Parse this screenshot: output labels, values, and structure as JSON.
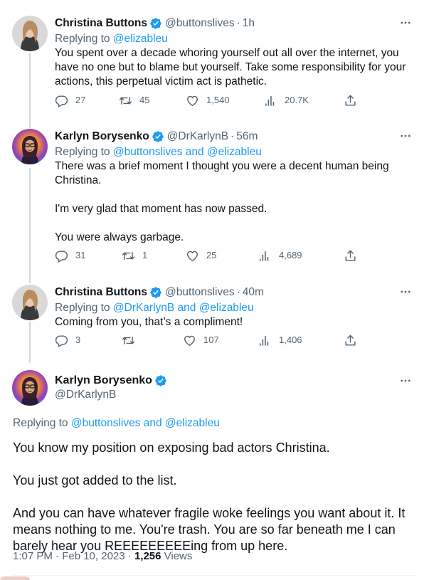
{
  "colors": {
    "accent": "#1d9bf0",
    "muted": "#536471",
    "text": "#0f1419",
    "verified": "#1d9bf0"
  },
  "tweets": [
    {
      "name": "Christina Buttons",
      "handle": "@buttonslives",
      "time": "1h",
      "replying_prefix": "Replying to ",
      "replying_to": "@elizableu",
      "text": "You spent over a decade whoring yourself out all over the internet, you have no one but to blame but yourself. Take some responsibility for your actions, this perpetual victim act is pathetic.",
      "replies": "27",
      "retweets": "45",
      "likes": "1,540",
      "views": "20.7K"
    },
    {
      "name": "Karlyn Borysenko",
      "handle": "@DrKarlynB",
      "time": "56m",
      "replying_prefix": "Replying to ",
      "replying_to": "@buttonslives and @elizableu",
      "text": "There was a brief moment I thought you were a decent human being Christina.\n\nI'm very glad that moment has now passed.\n\nYou were always garbage.",
      "replies": "31",
      "retweets": "1",
      "likes": "25",
      "views": "4,689"
    },
    {
      "name": "Christina Buttons",
      "handle": "@buttonslives",
      "time": "40m",
      "replying_prefix": "Replying to ",
      "replying_to": "@DrKarlynB and @elizableu",
      "text": "Coming from you, that’s a compliment!",
      "replies": "3",
      "retweets": "",
      "likes": "107",
      "views": "1,406"
    }
  ],
  "main": {
    "name": "Karlyn Borysenko",
    "handle": "@DrKarlynB",
    "replying_prefix": "Replying to ",
    "replying_to": "@buttonslives and @elizableu",
    "text": "You know my position on exposing bad actors Christina.\n\nYou just got added to the list.\n\nAnd you can have whatever fragile woke feelings you want about it. It means nothing to me. You're trash. You are so far beneath me I can barely hear you REEEEEEEEEing from up here.",
    "timestamp": "1:07 PM · Feb 10, 2023 · ",
    "views_count": "1,256",
    "views_label": " Views"
  },
  "icons": [
    "more-icon",
    "verified-icon",
    "reply-icon",
    "retweet-icon",
    "like-icon",
    "views-icon",
    "share-icon"
  ]
}
